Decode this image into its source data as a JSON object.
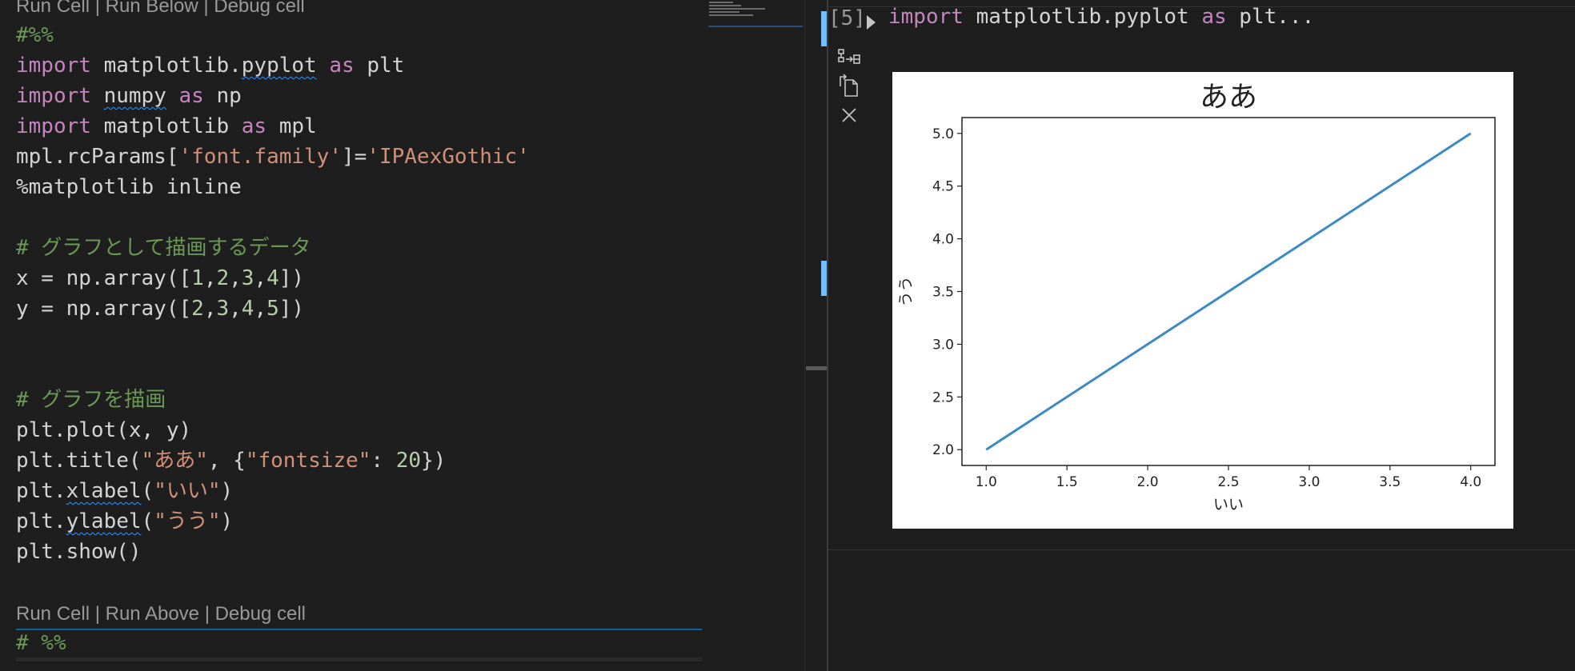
{
  "editor": {
    "codelens_top": "Run Cell | Run Below | Debug cell",
    "codelens_bottom": "Run Cell | Run Above | Debug cell",
    "lines": {
      "l1": "#%%",
      "l2_kw": "import",
      "l2_mod": "matplotlib.",
      "l2_sq": "pyplot",
      "l2_as": "as",
      "l2_alias": "plt",
      "l3_kw": "import",
      "l3_sq": "numpy",
      "l3_as": "as",
      "l3_alias": "np",
      "l4_kw": "import",
      "l4_mod": "matplotlib",
      "l4_as": "as",
      "l4_alias": "mpl",
      "l5_a": "mpl.rcParams[",
      "l5_s1": "'font.family'",
      "l5_b": "]=",
      "l5_s2": "'IPAexGothic'",
      "l6": "%matplotlib inline",
      "l8": "# グラフとして描画するデータ",
      "l9_a": "x = np.array([",
      "l9_n": [
        "1",
        "2",
        "3",
        "4"
      ],
      "l9_b": "])",
      "l10_a": "y = np.array([",
      "l10_n": [
        "2",
        "3",
        "4",
        "5"
      ],
      "l10_b": "])",
      "l13": "# グラフを描画",
      "l14": "plt.plot(x, y)",
      "l15_a": "plt.title(",
      "l15_s1": "\"ああ\"",
      "l15_b": ", {",
      "l15_s2": "\"fontsize\"",
      "l15_c": ": ",
      "l15_n": "20",
      "l15_d": "})",
      "l16_a": "plt.",
      "l16_sq": "xlabel",
      "l16_b": "(",
      "l16_s": "\"いい\"",
      "l16_c": ")",
      "l17_a": "plt.",
      "l17_sq": "ylabel",
      "l17_b": "(",
      "l17_s": "\"うう\"",
      "l17_c": ")",
      "l18": "plt.show()",
      "l20": "# %%"
    }
  },
  "interactive": {
    "exec_count": "[5]",
    "collapsed_kw": "import",
    "collapsed_rest": " matplotlib.pyplot ",
    "collapsed_as": "as",
    "collapsed_tail": " plt...",
    "icons": [
      "variable-view-icon",
      "export-icon",
      "close-icon"
    ]
  },
  "colors": {
    "background": "#1e1e1e",
    "keyword": "#c586c0",
    "string": "#ce9178",
    "number": "#b5cea8",
    "comment": "#6a9955",
    "plot_line": "#3b8bc2"
  },
  "chart_data": {
    "type": "line",
    "title": "ああ",
    "xlabel": "いい",
    "ylabel": "うう",
    "x": [
      1,
      2,
      3,
      4
    ],
    "series": [
      {
        "values": [
          2,
          3,
          4,
          5
        ]
      }
    ],
    "xlim": [
      0.85,
      4.15
    ],
    "ylim": [
      1.85,
      5.15
    ],
    "xticks": [
      1.0,
      1.5,
      2.0,
      2.5,
      3.0,
      3.5,
      4.0
    ],
    "yticks": [
      2.0,
      2.5,
      3.0,
      3.5,
      4.0,
      4.5,
      5.0
    ],
    "xtick_labels": [
      "1.0",
      "1.5",
      "2.0",
      "2.5",
      "3.0",
      "3.5",
      "4.0"
    ],
    "ytick_labels": [
      "2.0",
      "2.5",
      "3.0",
      "3.5",
      "4.0",
      "4.5",
      "5.0"
    ],
    "grid": false
  }
}
